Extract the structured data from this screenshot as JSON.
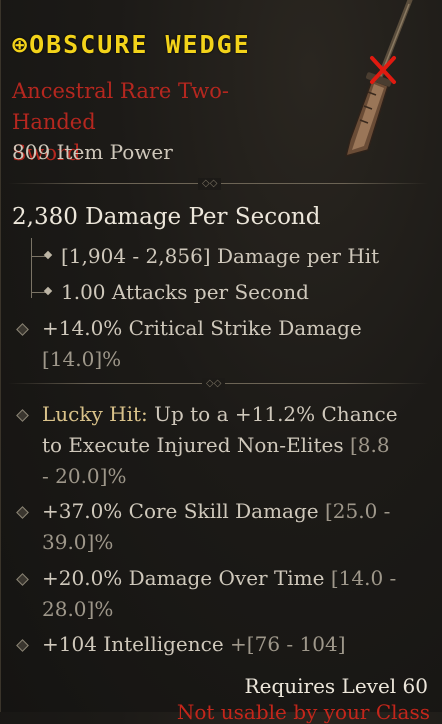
{
  "item": {
    "name": "OBSCURE WEDGE",
    "rarity_line1": "Ancestral Rare Two-Handed",
    "rarity_line2": "Sword",
    "item_power": "809 Item Power",
    "dps": "2,380 Damage Per Second",
    "damage_per_hit": "[1,904 - 2,856] Damage per Hit",
    "attacks_per_second": "1.00 Attacks per Second",
    "implicit": {
      "text": "+14.0% Critical Strike Damage",
      "range": "[14.0]%"
    },
    "affixes": [
      {
        "prefix": "Lucky Hit:",
        "text": " Up to a +11.2% Chance to Execute Injured Non-Elites ",
        "range": "[8.8 - 20.0]%"
      },
      {
        "text": "+37.0% Core Skill Damage ",
        "range": "[25.0 - 39.0]%"
      },
      {
        "text": "+20.0% Damage Over Time ",
        "range": "[14.0 - 28.0]%"
      },
      {
        "text": "+104 Intelligence ",
        "range": "+[76 - 104]"
      }
    ],
    "requirement": "Requires Level 60",
    "class_restriction": "Not usable by your Class"
  },
  "colors": {
    "name": "#f3d31a",
    "rarity": "#b5271f",
    "lucky_hit": "#d9c28a",
    "range": "#9e978a",
    "unusable_marker": "#e01a10"
  },
  "icons": {
    "title_prefix": "crosshair-circle-icon",
    "item_image": "sword-icon",
    "unusable": "red-x-icon",
    "bullet": "diamond-bullet-icon",
    "divider": "double-diamond-ornament-icon"
  }
}
